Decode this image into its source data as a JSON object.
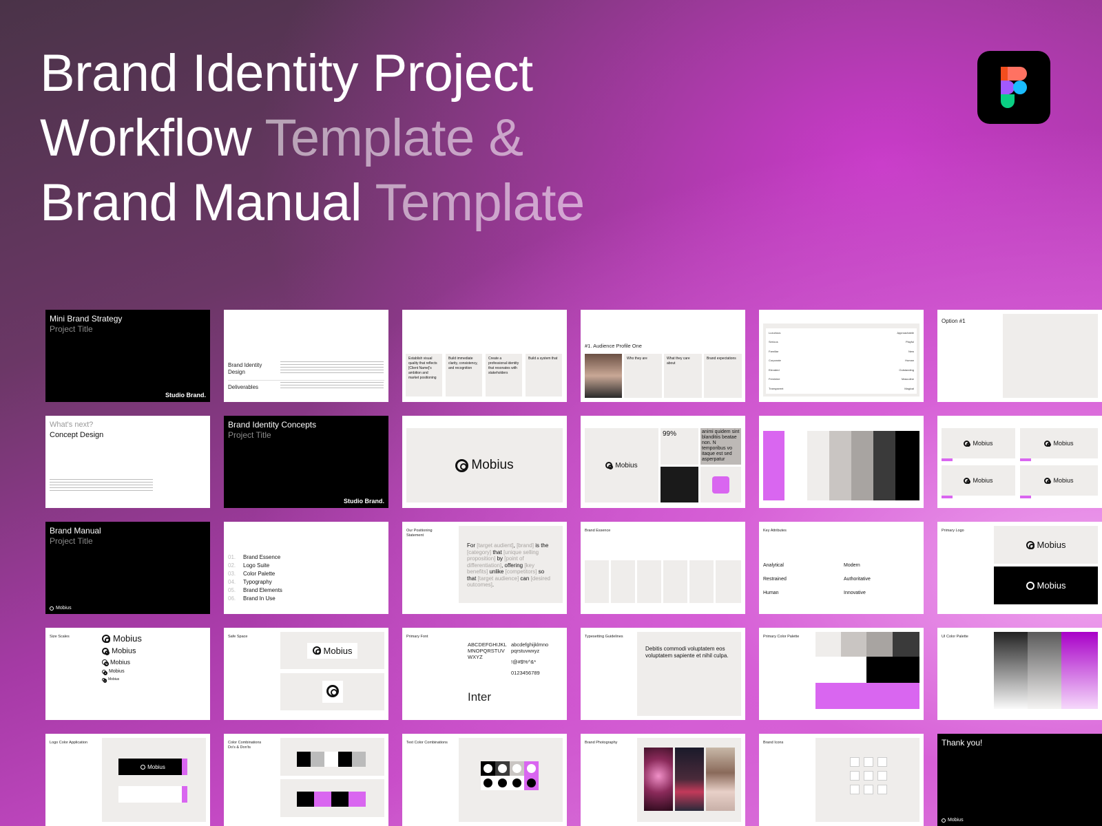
{
  "headline": {
    "line1": "Brand Identity Project",
    "line2_white": "Workflow ",
    "line2_dim": "Template &",
    "line3_white": "Brand Manual ",
    "line3_dim": "Template"
  },
  "figma_icon": "figma-icon",
  "colors": {
    "accent": "#d966f0",
    "dark": "#000000",
    "panel": "#efedeb"
  },
  "slides": {
    "s1": {
      "title": "Mini Brand Strategy",
      "subtitle": "Project Title",
      "brand": "Studio Brand."
    },
    "s2": {
      "item1": "Brand Identity Design",
      "item2": "Deliverables"
    },
    "s3": {
      "c1": "Establish visual quality that reflects [Client Name]'s ambition and market positioning",
      "c2": "Build immediate clarity, consistency, and recognition",
      "c3": "Create a professional identity that resonates with stakeholders",
      "c4": "Build a system that"
    },
    "s4": {
      "title": "#1. Audience Profile One",
      "h1": "Who they are",
      "h2": "What they care about",
      "h3": "Brand expectations"
    },
    "s5": {
      "rows": [
        [
          "Luxurious",
          "Approachable"
        ],
        [
          "Serious",
          "Playful"
        ],
        [
          "Familiar",
          "New"
        ],
        [
          "Corporate",
          "Human"
        ],
        [
          "Elevated",
          "Outstanding"
        ],
        [
          "Feminine",
          "Masculine"
        ],
        [
          "Transparent",
          "Magical"
        ]
      ]
    },
    "s6": {
      "title": "Option #1"
    },
    "s7": {
      "title": "What's next?",
      "subtitle": "Concept Design"
    },
    "s8": {
      "title": "Brand Identity Concepts",
      "subtitle": "Project Title",
      "brand": "Studio Brand."
    },
    "s9": {
      "logo": "Mobius"
    },
    "s10": {
      "logo": "Mobius",
      "stat": "99%",
      "text": "animi quidem sint blanditiis beatae non. N temporibus vo itaque est sed asperpatur"
    },
    "s12": {
      "logo": "Mobius"
    },
    "s13": {
      "title": "Brand Manual",
      "subtitle": "Project Title",
      "logo": "Mobius"
    },
    "s14": {
      "items": [
        [
          "01.",
          "Brand Essence"
        ],
        [
          "02.",
          "Logo Suite"
        ],
        [
          "03.",
          "Color Palette"
        ],
        [
          "04.",
          "Typography"
        ],
        [
          "05.",
          "Brand Elements"
        ],
        [
          "06.",
          "Brand In Use"
        ]
      ]
    },
    "s15": {
      "title": "Our Positioning Statement",
      "p_for": "For ",
      "p_aud": "[target audient]",
      "p_c1": ", ",
      "p_brand": "[brand]",
      "p_is": " is the ",
      "p_cat": "[category]",
      "p_that": " that ",
      "p_usp": "[unique selling proposition]",
      "p_by": " by ",
      "p_pod": "[point of differentiation]",
      "p_off": ", offering ",
      "p_kb": "[key benefits]",
      "p_unl": " unlike ",
      "p_comp": "[competitors]",
      "p_so": " so that ",
      "p_aud2": "[target audience]",
      "p_can": " can ",
      "p_out": "[desired outcomes]",
      "p_end": "."
    },
    "s16": {
      "title": "Brand Essence"
    },
    "s17": {
      "title": "Key Attributes",
      "a1": "Analytical",
      "a2": "Restrained",
      "a3": "Human",
      "a4": "Modern",
      "a5": "Authoritative",
      "a6": "Innovative"
    },
    "s18": {
      "title": "Primary Logo",
      "logo": "Mobius"
    },
    "s19": {
      "title": "Size Scales",
      "logo": "Mobius"
    },
    "s20": {
      "title": "Safe Space",
      "logo": "Mobius"
    },
    "s21": {
      "title": "Primary Font",
      "upper": "ABCDEFGHIJKL MNOPQRSTUV WXYZ",
      "lower": "abcdefghijklmno pqrstuvwxyz",
      "sym": "!@#$%^&*",
      "num": "0123456789",
      "font": "Inter"
    },
    "s22": {
      "title": "Typesetting Guidelines",
      "head": "Debitis commodi voluptatem eos voluptatem sapiente et nihil culpa."
    },
    "s23": {
      "title": "Primary Color Palette"
    },
    "s24": {
      "title": "UI Color Palette"
    },
    "s25": {
      "title": "Logo Color Application",
      "logo": "Mobius"
    },
    "s26": {
      "title": "Color Combinations Do's & Don'ts"
    },
    "s27": {
      "title": "Text Color Combinations"
    },
    "s28": {
      "title": "Brand Photography"
    },
    "s29": {
      "title": "Brand Icons"
    },
    "s30": {
      "title": "Thank you!",
      "logo": "Mobius"
    }
  }
}
